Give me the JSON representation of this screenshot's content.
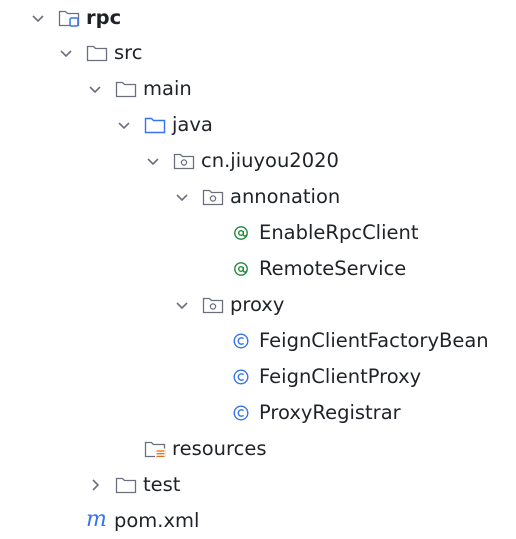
{
  "project_tree": {
    "root": {
      "label": "rpc",
      "icon": "module-folder-icon",
      "expanded": true
    },
    "src": {
      "label": "src",
      "icon": "folder-icon",
      "expanded": true
    },
    "main": {
      "label": "main",
      "icon": "folder-icon",
      "expanded": true
    },
    "java": {
      "label": "java",
      "icon": "source-root-folder-icon",
      "expanded": true
    },
    "package": {
      "label": "cn.jiuyou2020",
      "icon": "package-icon",
      "expanded": true
    },
    "annonation": {
      "label": "annonation",
      "icon": "package-icon",
      "expanded": true
    },
    "enable_rpc_client": {
      "label": "EnableRpcClient",
      "icon": "annotation-icon"
    },
    "remote_service": {
      "label": "RemoteService",
      "icon": "annotation-icon"
    },
    "proxy": {
      "label": "proxy",
      "icon": "package-icon",
      "expanded": true
    },
    "feign_client_factory_bean": {
      "label": "FeignClientFactoryBean",
      "icon": "class-icon"
    },
    "feign_client_proxy": {
      "label": "FeignClientProxy",
      "icon": "class-icon"
    },
    "proxy_registrar": {
      "label": "ProxyRegistrar",
      "icon": "class-icon"
    },
    "resources": {
      "label": "resources",
      "icon": "resources-folder-icon"
    },
    "test": {
      "label": "test",
      "icon": "folder-icon",
      "expanded": false
    },
    "pom": {
      "label": "pom.xml",
      "icon": "maven-icon"
    }
  },
  "colors": {
    "text": "#1f2328",
    "chevron": "#6c707e",
    "folder_stroke": "#6c707e",
    "source_root_stroke": "#3574f0",
    "annotation": "#208a3c",
    "class": "#3574f0",
    "maven": "#3574f0",
    "resources_lines": "#e66d17"
  }
}
